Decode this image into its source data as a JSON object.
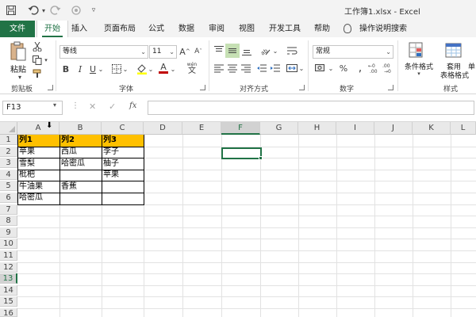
{
  "window": {
    "title": "工作簿1.xlsx  -  Excel"
  },
  "tabs": [
    "文件",
    "开始",
    "插入",
    "页面布局",
    "公式",
    "数据",
    "审阅",
    "视图",
    "开发工具",
    "帮助"
  ],
  "tell_me": "操作说明搜索",
  "ribbon": {
    "clipboard": {
      "paste_label": "粘贴",
      "group_label": "剪贴板"
    },
    "font": {
      "font_name": "等线",
      "font_size": "11",
      "grow_label": "A",
      "shrink_label": "A",
      "bold": "B",
      "italic": "I",
      "underline": "U",
      "underline_dropdown": "⌄",
      "font_color_label": "A",
      "font_color": "#c00000",
      "wen_label": "wén",
      "group_label": "字体"
    },
    "alignment": {
      "group_label": "对齐方式"
    },
    "number": {
      "format": "常规",
      "group_label": "数字"
    },
    "styles": {
      "conditional_format": "条件格式",
      "table_format_line1": "套用",
      "table_format_line2": "表格格式",
      "cell_styles_partial": "单",
      "group_label": "样式"
    }
  },
  "formula_bar": {
    "name_box": "F13",
    "fx_label": "fx",
    "value": ""
  },
  "sheet": {
    "columns": [
      "A",
      "B",
      "C",
      "D",
      "E",
      "F",
      "G",
      "H",
      "I",
      "J",
      "K",
      "L"
    ],
    "selected_column": "F",
    "rows": [
      "1",
      "2",
      "3",
      "4",
      "5",
      "6",
      "7",
      "8",
      "9",
      "10",
      "11",
      "12",
      "13",
      "14",
      "15",
      "16"
    ],
    "selected_row": "13",
    "active_cell": "F13",
    "header_fill": "#ffc000",
    "headers": [
      "列1",
      "列2",
      "列3"
    ],
    "cells": {
      "A2": "苹果",
      "B2": "西瓜",
      "C2": "李子",
      "A3": "雪梨",
      "B3": "哈密瓜",
      "C3": "柚子",
      "A4": "枇杷",
      "C4": "苹果",
      "A5": "牛油果",
      "B5": "香蕉",
      "A6": "哈密瓜"
    }
  },
  "colors": {
    "accent": "#217346"
  }
}
